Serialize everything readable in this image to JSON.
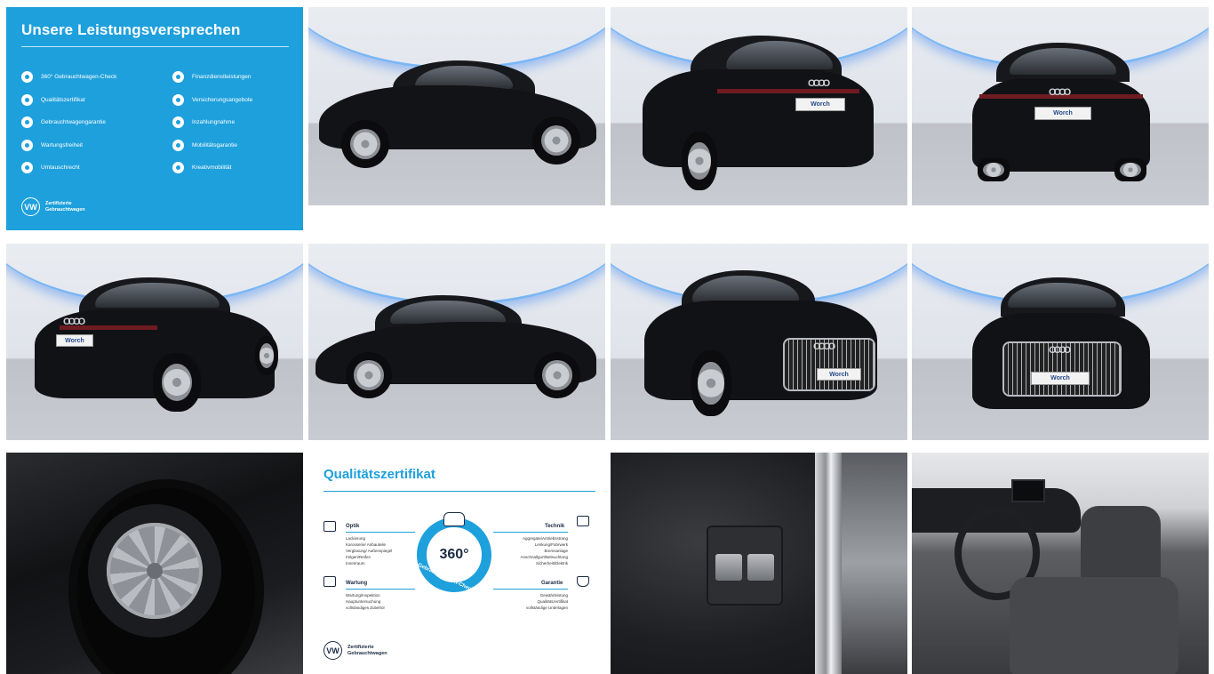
{
  "promise": {
    "title": "Unsere Leistungsversprechen",
    "left_items": [
      "360° Gebrauchtwagen-Check",
      "Qualitätszertifikat",
      "Gebrauchtwagengarantie",
      "Wartungsfreiheit",
      "Umtauschrecht"
    ],
    "right_items": [
      "Finanzdienstleistungen",
      "Versicherungsangebote",
      "Inzahlungnahme",
      "Mobilitätsgarantie",
      "Kreativmobilität"
    ],
    "brand_line1": "Zertifizierte",
    "brand_line2": "Gebrauchtwagen",
    "logo": "VW"
  },
  "plate_text": "Worch",
  "certificate": {
    "title": "Qualitätszertifikat",
    "center_value": "360°",
    "center_label": "Gebrauchtwagen-Check",
    "sections": {
      "optik": {
        "title": "Optik",
        "items": [
          "Lackierung",
          "Karosserie/ Anbauteile",
          "Verglasung/ Außenspiegel",
          "Felgen/Reifen",
          "Innenraum"
        ]
      },
      "technik": {
        "title": "Technik",
        "items": [
          "Aggregate/Antriebsstrang",
          "Lenkung/Fahrwerk",
          "Bremsanlage",
          "Anschnallgurt/Beleuchtung",
          "Sicherheit/Elektrik"
        ]
      },
      "wartung": {
        "title": "Wartung",
        "items": [
          "Wartung/Inspektion",
          "Hauptuntersuchung",
          "vollständiges Zubehör"
        ]
      },
      "garantie": {
        "title": "Garantie",
        "items": [
          "Gewährleistung",
          "Qualitätszertifikat",
          "vollständige Unterlagen"
        ]
      }
    },
    "brand_line1": "Zertifizierte",
    "brand_line2": "Gebrauchtwagen",
    "logo": "VW"
  },
  "colors": {
    "brand_blue": "#1ea0dc",
    "car_black": "#121317"
  },
  "icons": [
    "car-icon",
    "shield-icon",
    "wrench-icon",
    "trunk-open-icon",
    "fuel-door-icon"
  ]
}
